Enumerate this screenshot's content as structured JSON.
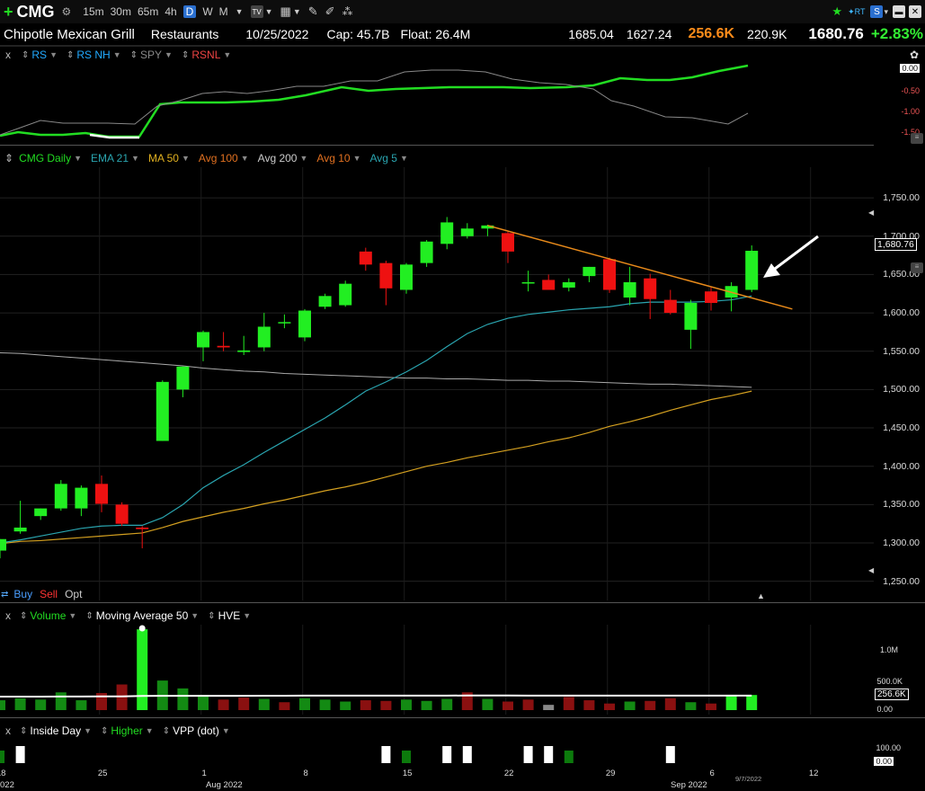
{
  "toolbar": {
    "symbol": "CMG",
    "timeframes": [
      "15m",
      "30m",
      "65m",
      "4h",
      "D",
      "W",
      "M"
    ],
    "active_timeframe": "D"
  },
  "info": {
    "company": "Chipotle Mexican Grill",
    "sector": "Restaurants",
    "date": "10/25/2022",
    "cap": "Cap: 45.7B",
    "float": "Float: 26.4M",
    "high": "1685.04",
    "low": "1627.24",
    "volume": "256.6K",
    "avg_volume": "220.9K",
    "last": "1680.76",
    "change": "+2.83%"
  },
  "rs_panel": {
    "close_label": "x",
    "items": [
      "RS",
      "RS NH",
      "SPY",
      "RSNL"
    ],
    "ticks": [
      "0.00",
      "-0.50",
      "-1.00",
      "-1.50"
    ]
  },
  "price_panel": {
    "items": [
      "CMG Daily",
      "EMA 21",
      "MA 50",
      "Avg 100",
      "Avg 200",
      "Avg 10",
      "Avg 5"
    ],
    "ticks": [
      "1,750.00",
      "1,700.00",
      "1,650.00",
      "1,600.00",
      "1,550.00",
      "1,500.00",
      "1,450.00",
      "1,400.00",
      "1,350.00",
      "1,300.00",
      "1,250.00"
    ],
    "price_label": "1,680.76"
  },
  "trade": {
    "buy": "Buy",
    "sell": "Sell",
    "opt": "Opt"
  },
  "volume_panel": {
    "close_label": "x",
    "items": [
      "Volume",
      "Moving Average 50",
      "HVE"
    ],
    "ticks": [
      "1.0M",
      "500.0K",
      "0.00"
    ],
    "value_label": "256.6K"
  },
  "signal_panel": {
    "close_label": "x",
    "items": [
      "Inside Day",
      "Higher",
      "VPP (dot)"
    ],
    "ticks": [
      "100.00",
      "0.00"
    ]
  },
  "x_axis": {
    "labels": [
      "18",
      "25",
      "1",
      "8",
      "15",
      "22",
      "29",
      "6",
      "12"
    ],
    "months": [
      "Aug 2022",
      "Sep 2022"
    ],
    "left_clip": "022",
    "current_date": "9/7/2022"
  },
  "colors": {
    "up": "#22ee22",
    "down": "#ee1111",
    "ema21": "#2aa5b0",
    "ma50": "#d4a020",
    "avg200": "#aaaaaa",
    "trendline": "#e88a1a",
    "rs": "#22dd22",
    "change": "#33ee33",
    "volume_hl": "#ff8c1a"
  },
  "chart_data": [
    {
      "type": "candlestick",
      "title": "CMG Daily",
      "ylim": [
        1225,
        1790
      ],
      "candles": [
        {
          "o": 1290,
          "h": 1305,
          "l": 1280,
          "c": 1305
        },
        {
          "o": 1315,
          "h": 1355,
          "l": 1312,
          "c": 1320
        },
        {
          "o": 1335,
          "h": 1345,
          "l": 1330,
          "c": 1345
        },
        {
          "o": 1345,
          "h": 1382,
          "l": 1342,
          "c": 1377
        },
        {
          "o": 1345,
          "h": 1375,
          "l": 1335,
          "c": 1372
        },
        {
          "o": 1377,
          "h": 1388,
          "l": 1340,
          "c": 1351
        },
        {
          "o": 1350,
          "h": 1353,
          "l": 1322,
          "c": 1325
        },
        {
          "o": 1320,
          "h": 1322,
          "l": 1293,
          "c": 1318
        },
        {
          "o": 1433,
          "h": 1512,
          "l": 1433,
          "c": 1510
        },
        {
          "o": 1500,
          "h": 1530,
          "l": 1490,
          "c": 1530
        },
        {
          "o": 1555,
          "h": 1577,
          "l": 1537,
          "c": 1575
        },
        {
          "o": 1557,
          "h": 1575,
          "l": 1550,
          "c": 1555
        },
        {
          "o": 1549,
          "h": 1570,
          "l": 1545,
          "c": 1551
        },
        {
          "o": 1555,
          "h": 1600,
          "l": 1550,
          "c": 1582
        },
        {
          "o": 1588,
          "h": 1598,
          "l": 1580,
          "c": 1588
        },
        {
          "o": 1568,
          "h": 1605,
          "l": 1563,
          "c": 1603
        },
        {
          "o": 1608,
          "h": 1625,
          "l": 1605,
          "c": 1622
        },
        {
          "o": 1610,
          "h": 1642,
          "l": 1608,
          "c": 1638
        },
        {
          "o": 1680,
          "h": 1685,
          "l": 1655,
          "c": 1663
        },
        {
          "o": 1665,
          "h": 1668,
          "l": 1610,
          "c": 1632
        },
        {
          "o": 1630,
          "h": 1665,
          "l": 1625,
          "c": 1663
        },
        {
          "o": 1665,
          "h": 1695,
          "l": 1660,
          "c": 1693
        },
        {
          "o": 1690,
          "h": 1725,
          "l": 1683,
          "c": 1718
        },
        {
          "o": 1700,
          "h": 1717,
          "l": 1697,
          "c": 1710
        },
        {
          "o": 1710,
          "h": 1715,
          "l": 1700,
          "c": 1714
        },
        {
          "o": 1704,
          "h": 1706,
          "l": 1665,
          "c": 1680
        },
        {
          "o": 1640,
          "h": 1655,
          "l": 1628,
          "c": 1640
        },
        {
          "o": 1643,
          "h": 1650,
          "l": 1630,
          "c": 1630
        },
        {
          "o": 1633,
          "h": 1645,
          "l": 1628,
          "c": 1640
        },
        {
          "o": 1648,
          "h": 1660,
          "l": 1640,
          "c": 1660
        },
        {
          "o": 1670,
          "h": 1672,
          "l": 1626,
          "c": 1630
        },
        {
          "o": 1620,
          "h": 1660,
          "l": 1610,
          "c": 1640
        },
        {
          "o": 1645,
          "h": 1651,
          "l": 1592,
          "c": 1618
        },
        {
          "o": 1617,
          "h": 1630,
          "l": 1598,
          "c": 1600
        },
        {
          "o": 1578,
          "h": 1617,
          "l": 1553,
          "c": 1613
        },
        {
          "o": 1628,
          "h": 1633,
          "l": 1603,
          "c": 1613
        },
        {
          "o": 1620,
          "h": 1640,
          "l": 1602,
          "c": 1635
        },
        {
          "o": 1630,
          "h": 1688,
          "l": 1627,
          "c": 1681
        }
      ],
      "ema21": [
        1300,
        1304,
        1309,
        1314,
        1319,
        1322,
        1323,
        1323,
        1333,
        1350,
        1372,
        1388,
        1402,
        1418,
        1433,
        1448,
        1463,
        1480,
        1498,
        1510,
        1523,
        1538,
        1556,
        1573,
        1585,
        1593,
        1598,
        1601,
        1604,
        1606,
        1608,
        1612,
        1614,
        1614,
        1614,
        1615,
        1617,
        1622
      ],
      "ma50": [
        1299,
        1302,
        1303,
        1305,
        1307,
        1309,
        1311,
        1313,
        1320,
        1328,
        1334,
        1340,
        1345,
        1351,
        1356,
        1362,
        1368,
        1373,
        1379,
        1386,
        1393,
        1400,
        1405,
        1411,
        1416,
        1421,
        1426,
        1432,
        1437,
        1444,
        1452,
        1458,
        1465,
        1473,
        1480,
        1487,
        1492,
        1498
      ],
      "avg200": [
        1548,
        1547,
        1545,
        1543,
        1541,
        1539,
        1537,
        1535,
        1533,
        1531,
        1528,
        1526,
        1524,
        1523,
        1521,
        1520,
        1519,
        1518,
        1517,
        1516,
        1515,
        1515,
        1514,
        1514,
        1513,
        1512,
        1512,
        1511,
        1511,
        1510,
        1509,
        1508,
        1507,
        1507,
        1506,
        1505,
        1504,
        1503
      ],
      "trendline": {
        "from": {
          "bar": 24,
          "value": 1714
        },
        "to": {
          "bar": 39,
          "value": 1605
        }
      }
    },
    {
      "type": "bar",
      "title": "Volume",
      "ylim": [
        0,
        1300
      ],
      "values": [
        150,
        180,
        160,
        270,
        150,
        260,
        390,
        1230,
        450,
        330,
        230,
        160,
        190,
        170,
        120,
        180,
        160,
        130,
        150,
        140,
        160,
        140,
        170,
        270,
        170,
        130,
        160,
        80,
        200,
        150,
        100,
        130,
        140,
        180,
        120,
        100,
        210,
        230
      ],
      "up": [
        true,
        true,
        true,
        true,
        true,
        false,
        false,
        true,
        true,
        true,
        true,
        false,
        false,
        true,
        false,
        true,
        true,
        true,
        false,
        false,
        true,
        true,
        true,
        false,
        true,
        false,
        false,
        false,
        false,
        false,
        false,
        true,
        false,
        false,
        true,
        false,
        true,
        true
      ],
      "ma50": [
        205,
        205,
        206,
        207,
        207,
        208,
        209,
        215,
        217,
        218,
        218,
        218,
        218,
        219,
        219,
        220,
        220,
        220,
        220,
        220,
        221,
        221,
        221,
        222,
        222,
        222,
        221,
        221,
        221,
        221,
        221,
        221,
        221,
        221,
        221,
        221,
        221,
        221
      ]
    },
    {
      "type": "bar",
      "title": "Inside Day / Higher",
      "ylim": [
        0,
        100
      ],
      "inside_day": [
        false,
        true,
        false,
        false,
        false,
        false,
        false,
        false,
        false,
        false,
        false,
        false,
        false,
        false,
        false,
        false,
        false,
        false,
        false,
        true,
        false,
        false,
        true,
        true,
        false,
        false,
        true,
        true,
        false,
        false,
        false,
        false,
        false,
        true,
        false,
        false,
        false,
        false
      ],
      "higher": [
        true,
        false,
        false,
        false,
        false,
        false,
        false,
        false,
        false,
        false,
        false,
        false,
        false,
        false,
        false,
        false,
        false,
        false,
        false,
        false,
        true,
        false,
        false,
        false,
        false,
        false,
        false,
        false,
        true,
        false,
        false,
        false,
        false,
        false,
        false,
        false,
        false,
        false
      ]
    }
  ]
}
